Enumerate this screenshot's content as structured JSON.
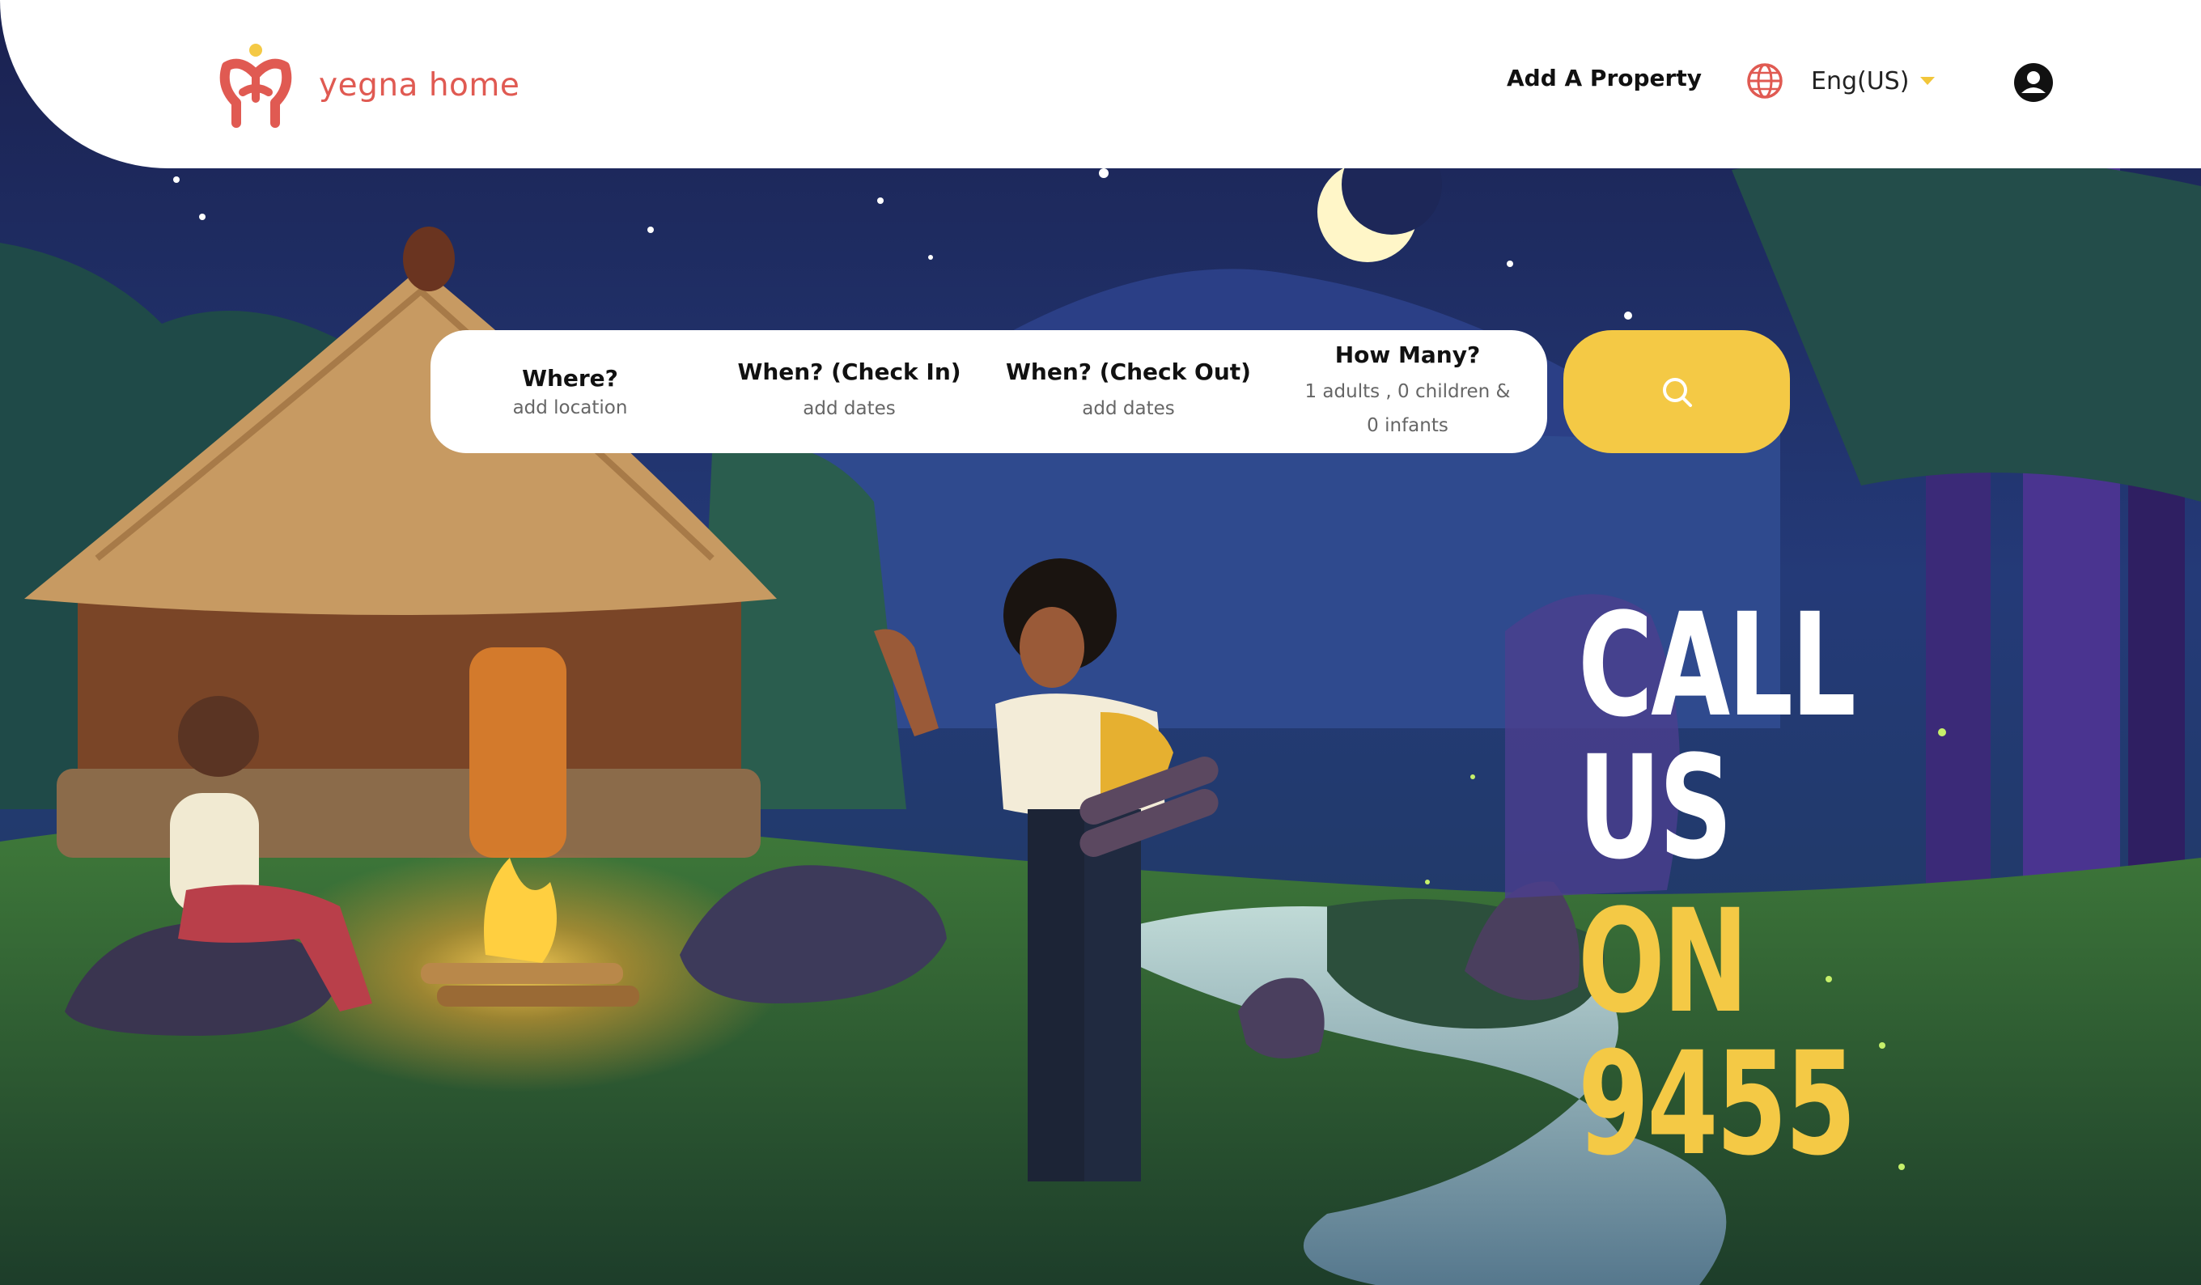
{
  "brand": {
    "name": "yegna home",
    "accent": "#e05a52"
  },
  "nav": {
    "add_property": "Add A Property",
    "language": "Eng(US)",
    "language_icon": "globe-icon",
    "account_icon": "user-avatar-icon"
  },
  "search": {
    "where": {
      "label": "Where?",
      "value": "add location"
    },
    "check_in": {
      "label": "When? (Check In)",
      "value": "add dates"
    },
    "check_out": {
      "label": "When? (Check Out)",
      "value": "add dates"
    },
    "guests": {
      "label": "How Many?",
      "value": "1 adults , 0 children & 0 infants"
    },
    "button_icon": "search-icon",
    "button_color": "#f4c945"
  },
  "hero": {
    "line1": "CALL US",
    "line2": "ON 9455",
    "line1_color": "#ffffff",
    "line2_color": "#f4c945",
    "illustration": "night-village-scene"
  }
}
